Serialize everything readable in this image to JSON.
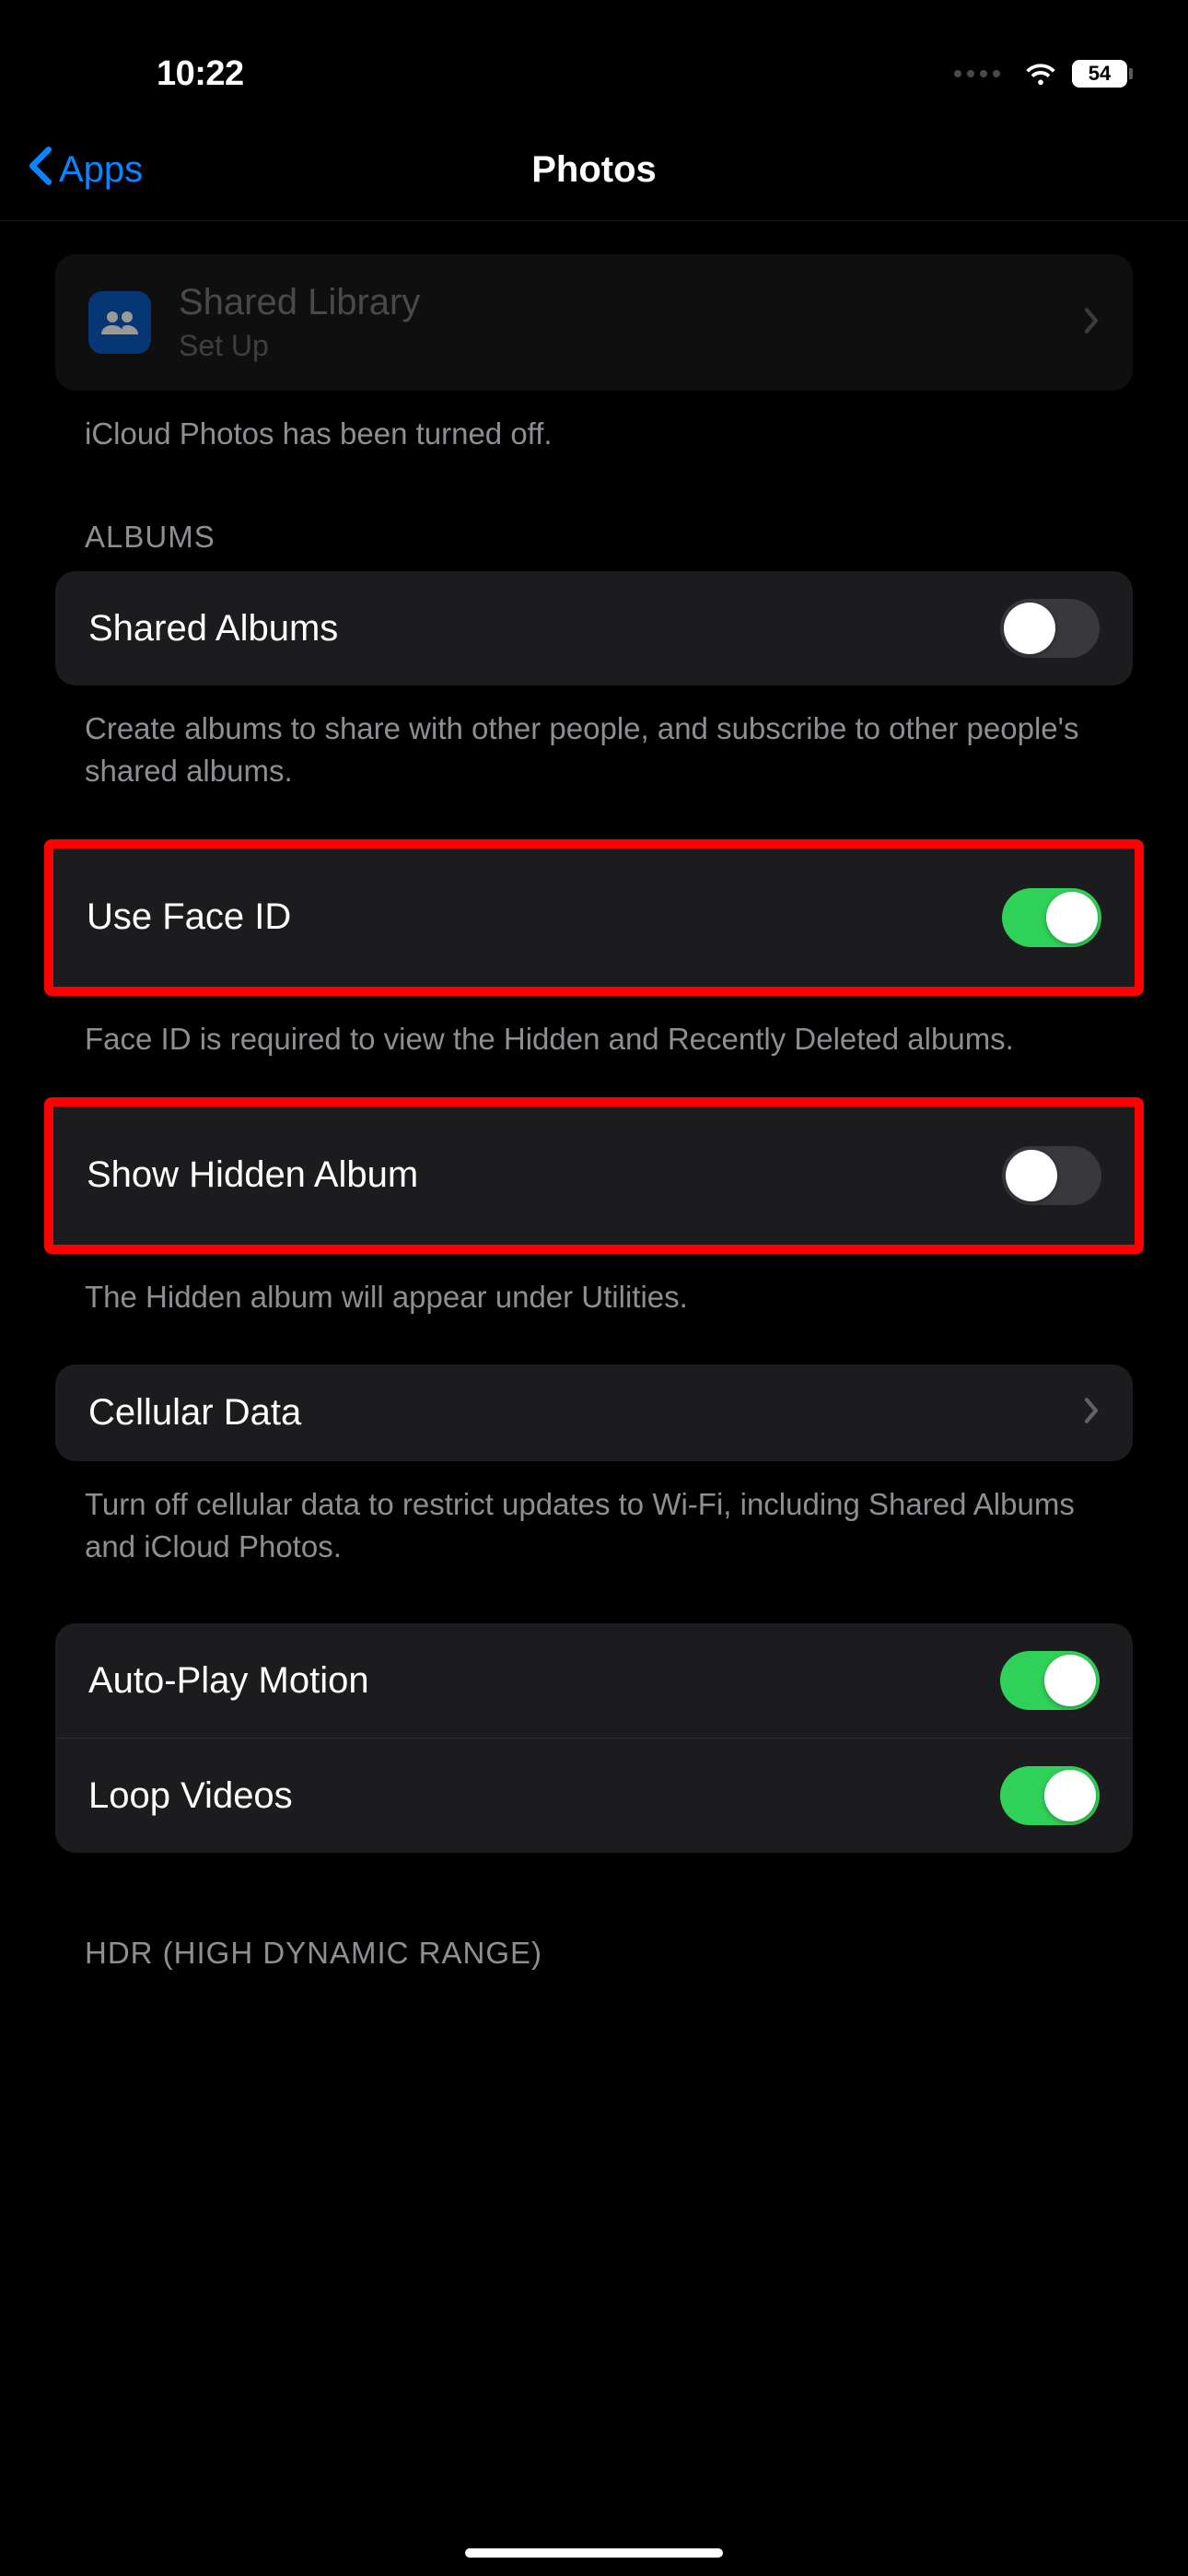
{
  "status": {
    "time": "10:22",
    "battery": "54"
  },
  "nav": {
    "back_label": "Apps",
    "title": "Photos"
  },
  "shared_library": {
    "title": "Shared Library",
    "subtitle": "Set Up"
  },
  "icloud_footer": "iCloud Photos has been turned off.",
  "albums_header": "ALBUMS",
  "shared_albums": {
    "label": "Shared Albums",
    "on": false,
    "footer": "Create albums to share with other people, and subscribe to other people's shared albums."
  },
  "face_id": {
    "label": "Use Face ID",
    "on": true,
    "footer": "Face ID is required to view the Hidden and Recently Deleted albums."
  },
  "hidden_album": {
    "label": "Show Hidden Album",
    "on": false,
    "footer": "The Hidden album will appear under Utilities."
  },
  "cellular": {
    "label": "Cellular Data",
    "footer": "Turn off cellular data to restrict updates to Wi-Fi, including Shared Albums and iCloud Photos."
  },
  "autoplay": {
    "label": "Auto-Play Motion",
    "on": true
  },
  "loop": {
    "label": "Loop Videos",
    "on": true
  },
  "hdr_header": "HDR (HIGH DYNAMIC RANGE)"
}
